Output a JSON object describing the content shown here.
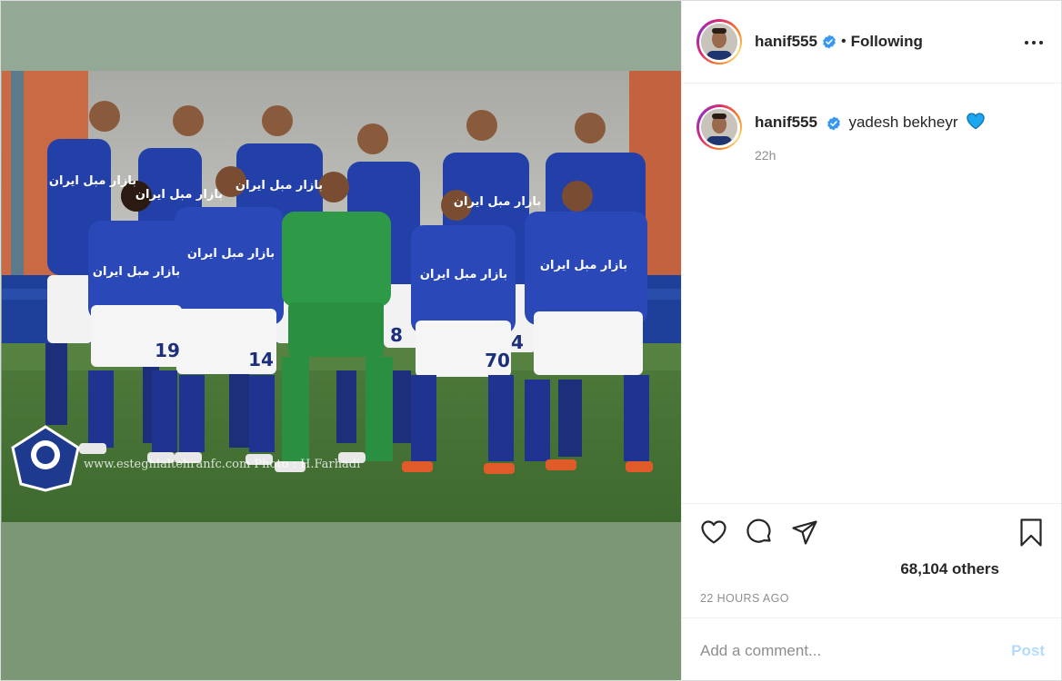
{
  "post": {
    "username": "hanif555",
    "separator": "•",
    "follow_status": "Following",
    "caption": {
      "username": "hanif555",
      "text": "yadesh bekheyr",
      "emoji_icon": "blue-heart-icon",
      "time": "22h"
    },
    "likes": "68,104 others",
    "timestamp": "22 HOURS AGO",
    "comment": {
      "placeholder": "Add a comment...",
      "value": "",
      "post_label": "Post"
    },
    "photo": {
      "jersey_text": "بازار مبل ایران",
      "shirt_numbers": [
        "19",
        "14",
        "8",
        "70",
        "4"
      ],
      "watermark": "www.esteghlaltehranfc.com Photo : H.Farhadi"
    }
  },
  "colors": {
    "accent": "#0095f6",
    "verified": "#3897f0",
    "post_disabled": "#b3dbff",
    "media_background": "#7b9776"
  }
}
